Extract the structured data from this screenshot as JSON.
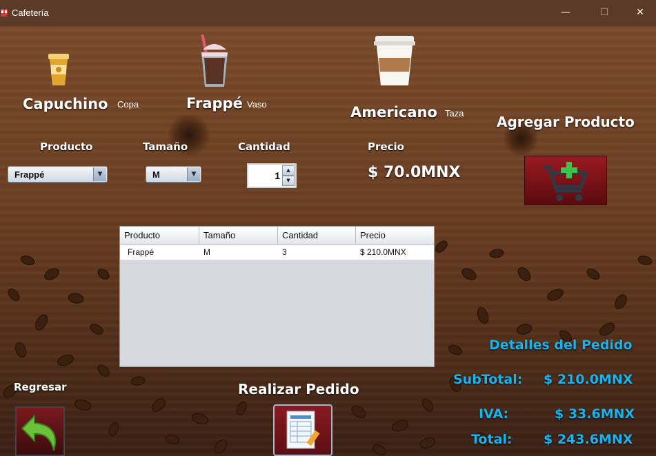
{
  "window": {
    "title": "Cafetería",
    "minimize_glyph": "—",
    "maximize_glyph": "☐",
    "close_glyph": "✕"
  },
  "products": [
    {
      "name": "Capuchino",
      "container": "Copa",
      "icon": "espresso-cup-icon"
    },
    {
      "name": "Frappé",
      "container": "Vaso",
      "icon": "frappe-glass-icon"
    },
    {
      "name": "Americano",
      "container": "Taza",
      "icon": "paper-cup-icon"
    }
  ],
  "form": {
    "producto_label": "Producto",
    "tamano_label": "Tamaño",
    "cantidad_label": "Cantidad",
    "precio_label": "Precio",
    "producto_value": "Frappé",
    "tamano_value": "M",
    "cantidad_value": "1",
    "precio_value": "$ 70.0MNX"
  },
  "add_product": {
    "label": "Agregar Producto",
    "icon": "cart-add-icon"
  },
  "table": {
    "headers": [
      "Producto",
      "Tamaño",
      "Cantidad",
      "Precio"
    ],
    "rows": [
      [
        "Frappé",
        "M",
        "3",
        "$ 210.0MNX"
      ]
    ]
  },
  "footer": {
    "back_label": "Regresar",
    "order_label": "Realizar Pedido"
  },
  "details": {
    "title": "Detalles del Pedido",
    "subtotal_label": "SubTotal:",
    "subtotal_value": "$ 210.0MNX",
    "iva_label": "IVA:",
    "iva_value": "$ 33.6MNX",
    "total_label": "Total:",
    "total_value": "$ 243.6MNX"
  },
  "colors": {
    "accent_blue": "#17b4f0",
    "button_red": "#8a1a22",
    "titlebar": "#5b3a27"
  }
}
